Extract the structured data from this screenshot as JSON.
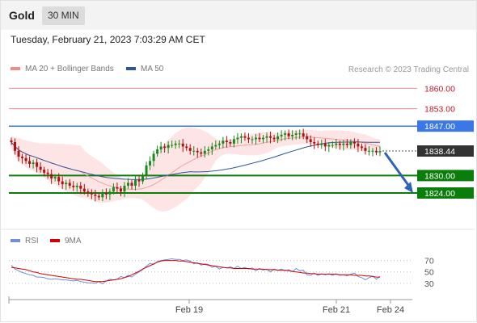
{
  "header": {
    "title": "Gold",
    "interval": "30 MIN"
  },
  "timestamp": "Tuesday, February 21, 2023 7:03:29 AM CET",
  "legend": {
    "ma_bb": "MA 20 + Bollinger Bands",
    "ma50": "MA 50",
    "credit": "Research © 2023 Trading Central"
  },
  "rsi_legend": {
    "rsi": "RSI",
    "ma9": "9MA"
  },
  "colors": {
    "resistance": "#f08b8b",
    "pivot_blue": "#3b78e7",
    "support_green": "#0a7d0a",
    "bollinger_fill": "#fde0e0",
    "ma20": "#f2a0a0",
    "ma50": "#2f5597",
    "candle_up": "#1a8a1a",
    "candle_down": "#b01010",
    "rsi_line": "#6f8fdb",
    "rsi_ma": "#d40000",
    "arrow": "#2e63b8"
  },
  "chart_data": {
    "type": "candlestick",
    "price_axis": {
      "min": 1814,
      "max": 1864
    },
    "levels": [
      {
        "value": 1860.0,
        "label": "1860.00",
        "kind": "resistance"
      },
      {
        "value": 1853.0,
        "label": "1853.00",
        "kind": "resistance"
      },
      {
        "value": 1847.0,
        "label": "1847.00",
        "kind": "pivot"
      },
      {
        "value": 1830.0,
        "label": "1830.00",
        "kind": "support"
      },
      {
        "value": 1824.0,
        "label": "1824.00",
        "kind": "support"
      }
    ],
    "current_price": {
      "value": 1838.44,
      "label": "1838.44"
    },
    "forecast_target": 1824.0,
    "x_ticks": [
      "Feb 19",
      "Feb 21",
      "Feb 24"
    ],
    "closes": [
      1841.5,
      1838.5,
      1836.5,
      1836.0,
      1835.0,
      1834.0,
      1834.5,
      1833.0,
      1832.0,
      1831.0,
      1830.5,
      1829.0,
      1829.5,
      1828.0,
      1827.0,
      1827.5,
      1826.5,
      1826.0,
      1826.5,
      1825.5,
      1824.5,
      1824.0,
      1823.5,
      1823.0,
      1822.5,
      1824.0,
      1823.5,
      1824.5,
      1826.0,
      1825.5,
      1824.5,
      1826.5,
      1827.5,
      1826.5,
      1828.5,
      1828.0,
      1830.0,
      1833.5,
      1835.0,
      1837.5,
      1839.0,
      1840.0,
      1839.5,
      1840.5,
      1840.5,
      1841.0,
      1841.0,
      1840.0,
      1839.5,
      1838.5,
      1838.5,
      1838.0,
      1837.5,
      1838.5,
      1839.0,
      1840.0,
      1840.5,
      1841.0,
      1842.0,
      1841.5,
      1841.0,
      1842.5,
      1843.0,
      1843.5,
      1843.0,
      1842.5,
      1842.5,
      1843.0,
      1842.5,
      1843.0,
      1843.5,
      1843.0,
      1842.5,
      1843.5,
      1844.0,
      1844.5,
      1843.5,
      1844.0,
      1844.5,
      1844.5,
      1843.5,
      1842.5,
      1841.5,
      1841.0,
      1840.5,
      1841.0,
      1840.0,
      1840.5,
      1840.5,
      1841.0,
      1840.5,
      1841.0,
      1840.5,
      1841.5,
      1841.0,
      1840.0,
      1839.5,
      1838.5,
      1838.5,
      1838.5,
      1838.0,
      1838.44
    ],
    "rsi": {
      "ticks": [
        70,
        50,
        30
      ],
      "range": [
        10,
        85
      ],
      "values": [
        62,
        55,
        52,
        49,
        47,
        45,
        44,
        41,
        41,
        40,
        38,
        37,
        38,
        37,
        36,
        36,
        35,
        34,
        35,
        33,
        32,
        31,
        31,
        30,
        33,
        29,
        34,
        37,
        36,
        37,
        42,
        40,
        44,
        41,
        46,
        50,
        54,
        60,
        65,
        63,
        68,
        70,
        71,
        72,
        73,
        72,
        72,
        70,
        71,
        69,
        64,
        66,
        62,
        64,
        63,
        58,
        60,
        55,
        58,
        57,
        59,
        56,
        60,
        56,
        58,
        55,
        57,
        52,
        56,
        53,
        55,
        50,
        55,
        53,
        55,
        52,
        54,
        50,
        56,
        52,
        53,
        45,
        44,
        48,
        44,
        47,
        45,
        47,
        44,
        47,
        44,
        45,
        43,
        46,
        48,
        42,
        40,
        36,
        40,
        43,
        37,
        42
      ],
      "ma9": [
        58,
        57,
        56,
        55,
        54,
        52,
        50,
        49,
        47,
        46,
        45,
        44,
        43,
        42,
        41,
        40,
        39,
        38,
        37,
        37,
        36,
        35,
        34,
        33,
        33,
        33,
        34,
        35,
        36,
        37,
        38,
        40,
        42,
        45,
        48,
        51,
        55,
        58,
        61,
        64,
        67,
        69,
        70,
        70,
        70,
        70,
        69,
        69,
        68,
        67,
        66,
        65,
        64,
        63,
        62,
        61,
        60,
        59,
        58,
        57,
        57,
        56,
        56,
        56,
        56,
        56,
        55,
        55,
        55,
        55,
        54,
        54,
        54,
        53,
        53,
        53,
        52,
        51,
        50,
        49,
        48,
        48,
        47,
        47,
        46,
        46,
        46,
        46,
        46,
        46,
        45,
        45,
        45,
        45,
        44,
        44,
        44,
        43,
        43,
        42,
        41,
        41
      ]
    }
  }
}
